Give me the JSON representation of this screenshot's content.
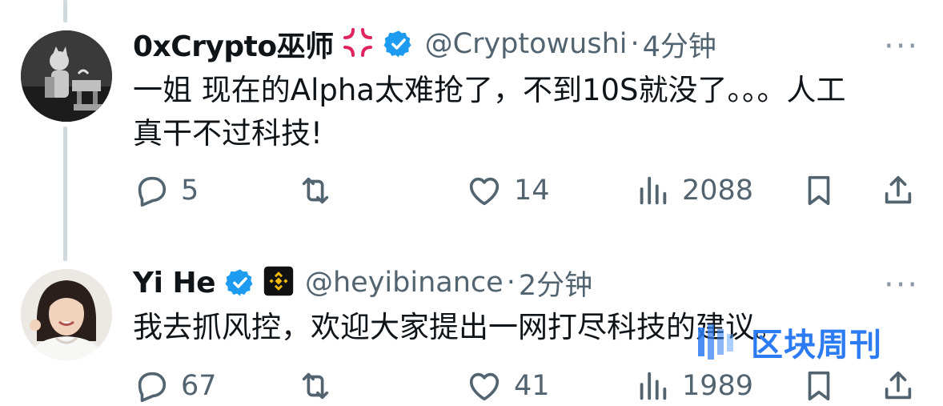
{
  "tweets": [
    {
      "name": "0xCrypto巫师",
      "name_emoji": "anger-symbol-icon",
      "handle": "@Cryptowushi",
      "time": "4分钟",
      "sep": "·",
      "text": "一姐 现在的Alpha太难抢了，不到10S就没了。。。人工\n真干不过科技!",
      "replies": "5",
      "likes": "14",
      "views": "2088"
    },
    {
      "name": "Yi He",
      "badge": "binance-logo-icon",
      "handle": "@heyibinance",
      "time": "2分钟",
      "sep": "·",
      "text": "我去抓风控，欢迎大家提出一网打尽科技的建议。",
      "replies": "67",
      "likes": "41",
      "views": "1989"
    }
  ],
  "more_label": "···",
  "watermark": {
    "text": "区块周刊"
  },
  "colors": {
    "verified": "#1d9bf0",
    "muted": "#536471",
    "watermark": "#2c7bf2",
    "binance": "#f0b90b"
  }
}
